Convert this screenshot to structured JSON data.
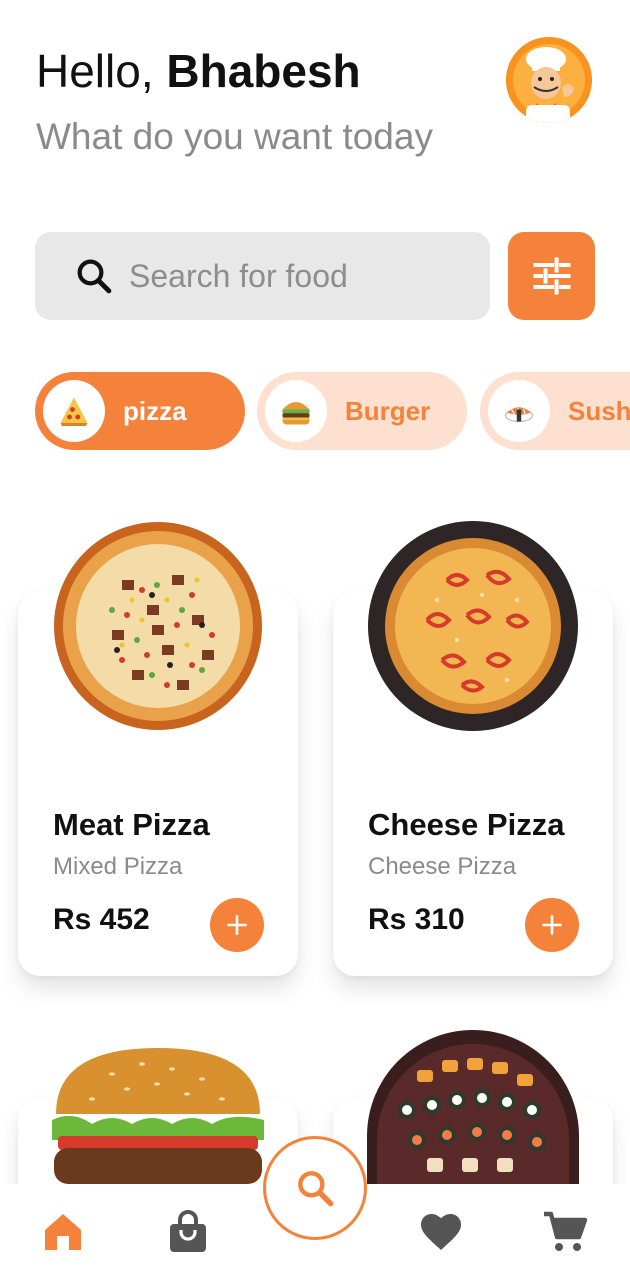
{
  "header": {
    "greeting_prefix": "Hello,",
    "user_name": "Bhabesh",
    "subtitle": "What do you want today"
  },
  "search": {
    "placeholder": "Search for food"
  },
  "categories": [
    {
      "label": "pizza",
      "icon": "pizza-icon",
      "active": true
    },
    {
      "label": "Burger",
      "icon": "burger-icon",
      "active": false
    },
    {
      "label": "Sushi",
      "icon": "sushi-icon",
      "active": false
    }
  ],
  "products": [
    {
      "name": "Meat Pizza",
      "category": "Mixed Pizza",
      "price": "Rs 452"
    },
    {
      "name": "Cheese Pizza",
      "category": "Cheese Pizza",
      "price": "Rs 310"
    }
  ],
  "bottom_nav": {
    "items": [
      "home-icon",
      "bag-icon",
      "search-icon",
      "heart-icon",
      "cart-icon"
    ],
    "active": "home-icon"
  },
  "colors": {
    "accent": "#f5823a",
    "accent_light": "#fde0d0",
    "search_bg": "#e8e8e8",
    "muted_text": "#8a8a8a",
    "icon_gray": "#555555"
  }
}
